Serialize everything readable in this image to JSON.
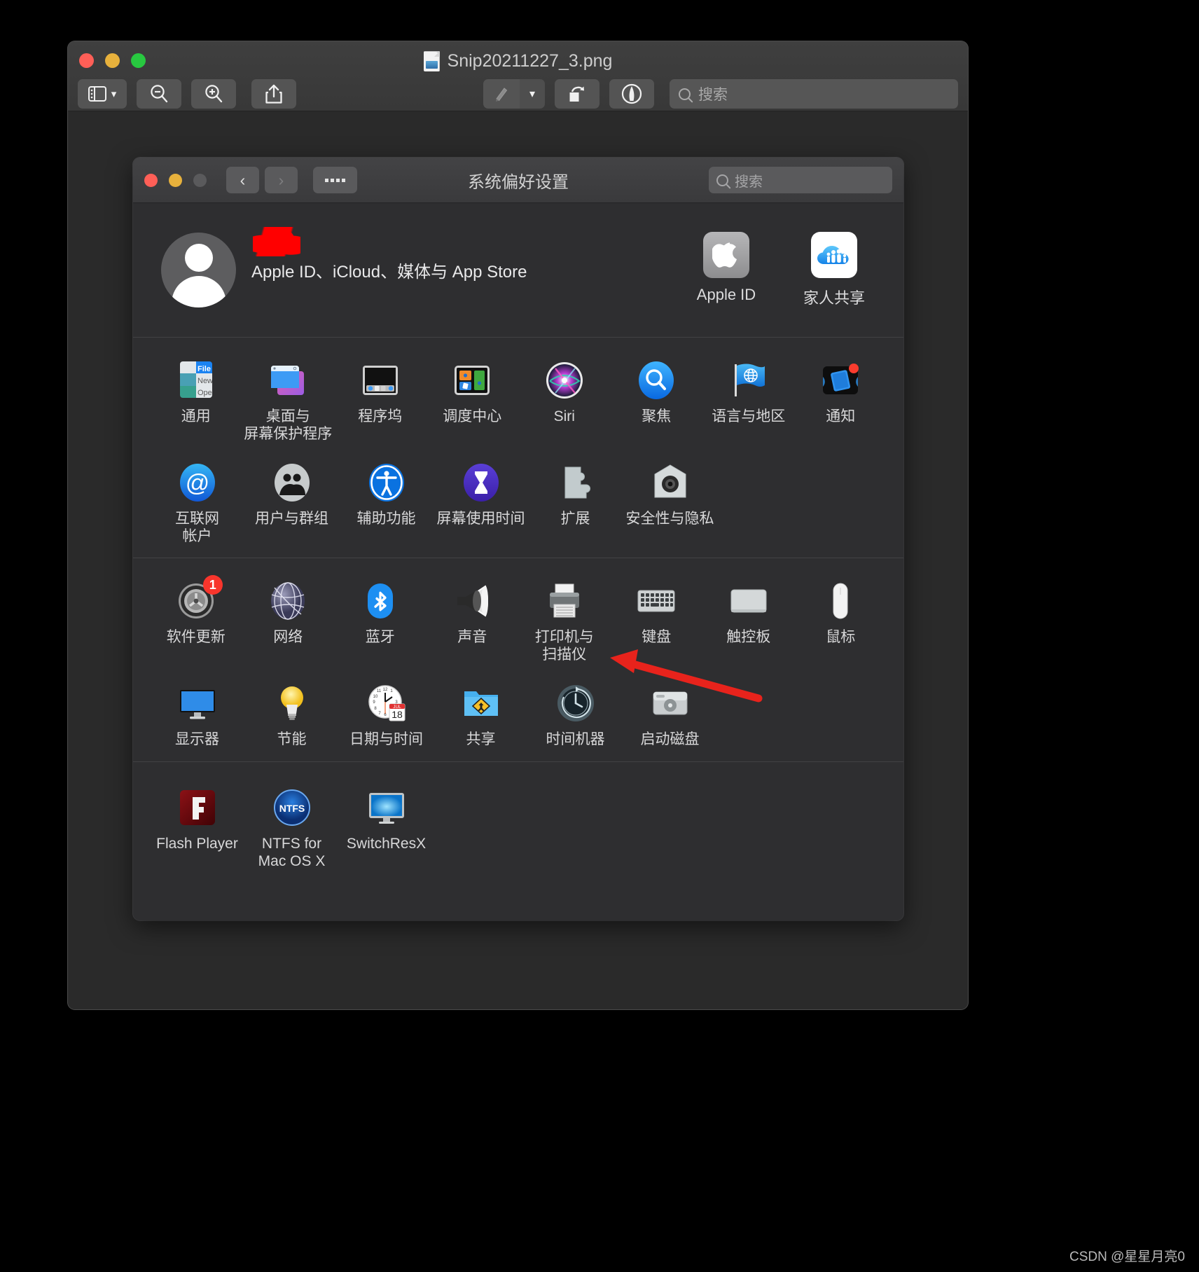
{
  "preview": {
    "title": "Snip20211227_3.png",
    "toolbar": {
      "sidebar_label": "sidebar-toggle",
      "zoom_out_label": "zoom-out",
      "zoom_in_label": "zoom-in",
      "share_label": "share",
      "markup_label": "markup",
      "markup_menu_label": "markup-options",
      "rotate_label": "rotate",
      "annotate_label": "annotate"
    },
    "search": {
      "placeholder": "搜索"
    }
  },
  "sysprefs": {
    "title": "系统偏好设置",
    "search": {
      "placeholder": "搜索"
    },
    "nav": {
      "back": "‹",
      "forward": "›"
    },
    "account": {
      "name_redacted": "",
      "subtitle": "Apple ID、iCloud、媒体与 App Store",
      "shortcuts": [
        {
          "label": "Apple ID",
          "icon": "apple-logo-icon"
        },
        {
          "label": "家人共享",
          "icon": "family-sharing-icon"
        }
      ]
    },
    "sections": [
      {
        "name": "personal",
        "rows": [
          [
            {
              "label": "通用",
              "icon": "general-icon"
            },
            {
              "label": "桌面与\n屏幕保护程序",
              "icon": "desktop-screensaver-icon"
            },
            {
              "label": "程序坞",
              "icon": "dock-icon"
            },
            {
              "label": "调度中心",
              "icon": "mission-control-icon"
            },
            {
              "label": "Siri",
              "icon": "siri-icon"
            },
            {
              "label": "聚焦",
              "icon": "spotlight-icon"
            },
            {
              "label": "语言与地区",
              "icon": "language-region-icon"
            },
            {
              "label": "通知",
              "icon": "notifications-icon"
            }
          ],
          [
            {
              "label": "互联网\n帐户",
              "icon": "internet-accounts-icon"
            },
            {
              "label": "用户与群组",
              "icon": "users-groups-icon"
            },
            {
              "label": "辅助功能",
              "icon": "accessibility-icon"
            },
            {
              "label": "屏幕使用时间",
              "icon": "screen-time-icon"
            },
            {
              "label": "扩展",
              "icon": "extensions-icon"
            },
            {
              "label": "安全性与隐私",
              "icon": "security-privacy-icon"
            }
          ]
        ]
      },
      {
        "name": "hardware",
        "rows": [
          [
            {
              "label": "软件更新",
              "icon": "software-update-icon",
              "badge": "1"
            },
            {
              "label": "网络",
              "icon": "network-icon"
            },
            {
              "label": "蓝牙",
              "icon": "bluetooth-icon"
            },
            {
              "label": "声音",
              "icon": "sound-icon"
            },
            {
              "label": "打印机与\n扫描仪",
              "icon": "printers-scanners-icon"
            },
            {
              "label": "键盘",
              "icon": "keyboard-icon"
            },
            {
              "label": "触控板",
              "icon": "trackpad-icon"
            },
            {
              "label": "鼠标",
              "icon": "mouse-icon"
            }
          ],
          [
            {
              "label": "显示器",
              "icon": "displays-icon"
            },
            {
              "label": "节能",
              "icon": "energy-saver-icon"
            },
            {
              "label": "日期与时间",
              "icon": "date-time-icon"
            },
            {
              "label": "共享",
              "icon": "sharing-icon"
            },
            {
              "label": "时间机器",
              "icon": "time-machine-icon"
            },
            {
              "label": "启动磁盘",
              "icon": "startup-disk-icon"
            }
          ]
        ]
      },
      {
        "name": "third-party",
        "rows": [
          [
            {
              "label": "Flash Player",
              "icon": "flash-player-icon"
            },
            {
              "label": "NTFS for\nMac OS X",
              "icon": "ntfs-icon"
            },
            {
              "label": "SwitchResX",
              "icon": "switchresx-icon"
            }
          ]
        ]
      }
    ]
  },
  "annotation": {
    "arrow_color": "#e8231c"
  },
  "watermark": "CSDN @星星月亮0",
  "calendar_icon": {
    "month": "JUL",
    "day": "18"
  },
  "general_icon_text": {
    "line1": "File",
    "line2": "New",
    "line3": "Ope"
  },
  "ntfs_icon_text": "NTFS"
}
